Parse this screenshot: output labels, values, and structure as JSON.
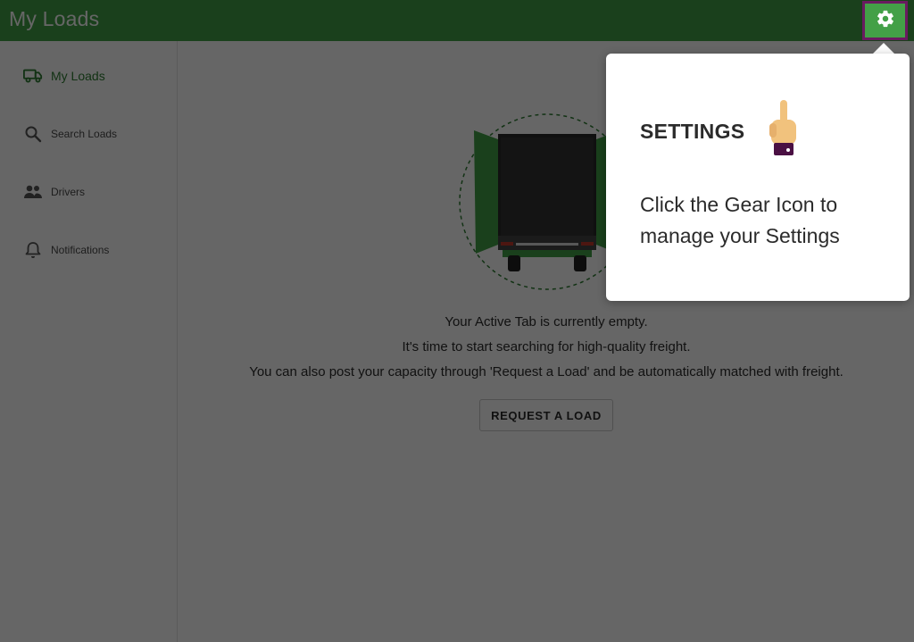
{
  "header": {
    "title": "My Loads",
    "gear_icon": "gear-icon",
    "color": "#43a047"
  },
  "sidebar": {
    "items": [
      {
        "label": "My Loads",
        "icon": "truck-icon",
        "active": true
      },
      {
        "label": "Search Loads",
        "icon": "search-icon",
        "active": false
      },
      {
        "label": "Drivers",
        "icon": "people-icon",
        "active": false
      },
      {
        "label": "Notifications",
        "icon": "bell-icon",
        "active": false
      }
    ]
  },
  "main": {
    "empty_lines": [
      "Your Active Tab is currently empty.",
      "It's time to start searching for high-quality freight.",
      "You can also post your capacity through 'Request a Load' and be automatically matched with freight."
    ],
    "request_button_label": "REQUEST A LOAD"
  },
  "tooltip": {
    "title": "SETTINGS",
    "body": "Click the Gear Icon to manage your Settings",
    "icon": "pointing-hand-icon"
  },
  "colors": {
    "brand_green": "#43a047",
    "active_nav": "#2e7d32",
    "highlight_border": "#6a1b60"
  }
}
